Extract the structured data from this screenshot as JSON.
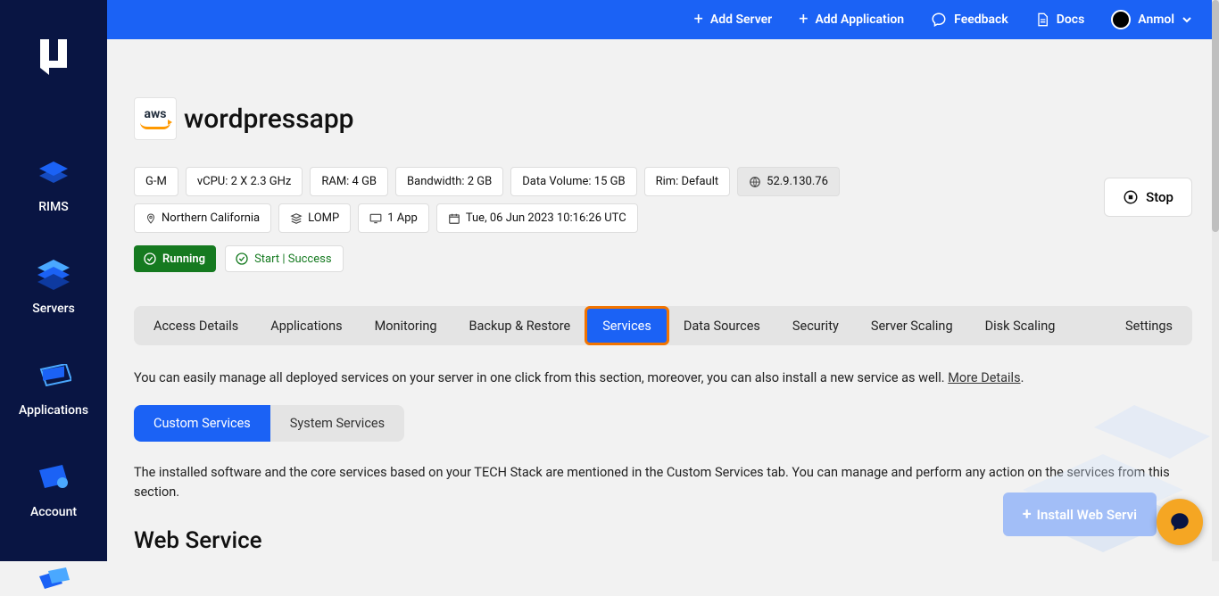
{
  "topbar": {
    "add_server": "Add Server",
    "add_application": "Add Application",
    "feedback": "Feedback",
    "docs": "Docs",
    "username": "Anmol"
  },
  "sidebar": {
    "items": [
      {
        "label": "RIMS"
      },
      {
        "label": "Servers"
      },
      {
        "label": "Applications"
      },
      {
        "label": "Account"
      },
      {
        "label": ""
      }
    ]
  },
  "server": {
    "provider": "aws",
    "title": "wordpressapp",
    "chips": {
      "plan": "G-M",
      "vcpu": "vCPU: 2 X 2.3 GHz",
      "ram": "RAM: 4 GB",
      "bandwidth": "Bandwidth: 2 GB",
      "data_volume": "Data Volume: 15 GB",
      "rim": "Rim: Default",
      "ip": "52.9.130.76",
      "region": "Northern California",
      "stack": "LOMP",
      "apps": "1 App",
      "created": "Tue, 06 Jun 2023 10:16:26 UTC"
    },
    "status": "Running",
    "last_action": "Start | Success",
    "stop_label": "Stop"
  },
  "tabs": [
    "Access Details",
    "Applications",
    "Monitoring",
    "Backup & Restore",
    "Services",
    "Data Sources",
    "Security",
    "Server Scaling",
    "Disk Scaling",
    "Settings"
  ],
  "active_tab": "Services",
  "services_intro": {
    "text": "You can easily manage all deployed services on your server in one click from this section, moreover, you can also install a new service as well. ",
    "link": "More Details",
    "period": "."
  },
  "subtabs": {
    "custom": "Custom Services",
    "system": "System Services"
  },
  "services_desc": "The installed software and the core services based on your TECH Stack are mentioned in the Custom Services tab. You can manage and perform any action on the services from this section.",
  "section_title": "Web Service",
  "install_button": "Install Web Servi"
}
